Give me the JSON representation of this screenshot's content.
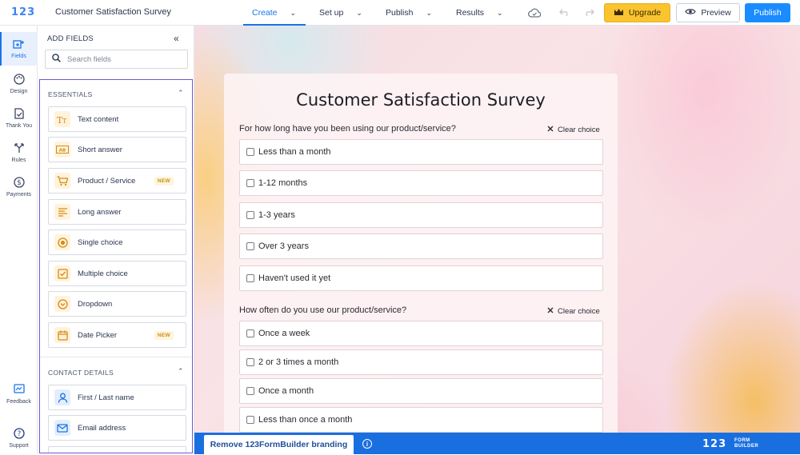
{
  "app": {
    "logo": "123",
    "form_title": "Customer Satisfaction Survey"
  },
  "nav": [
    {
      "label": "Create",
      "active": true
    },
    {
      "label": "Set up",
      "active": false
    },
    {
      "label": "Publish",
      "active": false
    },
    {
      "label": "Results",
      "active": false
    }
  ],
  "toolbar": {
    "cloud_icon": "cloud-icon",
    "undo_icon": "undo-icon",
    "redo_icon": "redo-icon",
    "upgrade_label": "Upgrade",
    "preview_label": "Preview",
    "publish_label": "Publish",
    "colors": {
      "upgrade": "#f9c430",
      "publish": "#1a8cff",
      "accent": "#1a73e8"
    }
  },
  "rail": {
    "items": [
      {
        "label": "Fields",
        "icon": "fields-icon",
        "active": true
      },
      {
        "label": "Design",
        "icon": "palette-icon",
        "active": false
      },
      {
        "label": "Thank You",
        "icon": "thankyou-icon",
        "active": false
      },
      {
        "label": "Rules",
        "icon": "rules-icon",
        "active": false
      },
      {
        "label": "Payments",
        "icon": "dollar-icon",
        "active": false
      }
    ],
    "feedback_label": "Feedback",
    "support_label": "Support"
  },
  "panel": {
    "title": "ADD FIELDS",
    "search_placeholder": "Search fields",
    "sections": [
      {
        "title": "ESSENTIALS",
        "fields": [
          {
            "label": "Text content",
            "icon": "text-content-icon",
            "badge": ""
          },
          {
            "label": "Short answer",
            "icon": "short-answer-icon",
            "badge": ""
          },
          {
            "label": "Product / Service",
            "icon": "cart-icon",
            "badge": "NEW"
          },
          {
            "label": "Long answer",
            "icon": "long-answer-icon",
            "badge": ""
          },
          {
            "label": "Single choice",
            "icon": "radio-icon",
            "badge": ""
          },
          {
            "label": "Multiple choice",
            "icon": "checkbox-icon",
            "badge": ""
          },
          {
            "label": "Dropdown",
            "icon": "dropdown-icon",
            "badge": ""
          },
          {
            "label": "Date Picker",
            "icon": "calendar-icon",
            "badge": "NEW"
          }
        ]
      },
      {
        "title": "CONTACT DETAILS",
        "fields": [
          {
            "label": "First / Last name",
            "icon": "person-icon",
            "badge": ""
          },
          {
            "label": "Email address",
            "icon": "email-icon",
            "badge": ""
          }
        ]
      }
    ]
  },
  "form": {
    "title": "Customer Satisfaction Survey",
    "clear_label": "Clear choice",
    "questions": [
      {
        "label": "For how long have you been using our product/service?",
        "options": [
          "Less than a month",
          "1-12 months",
          "1-3 years",
          "Over 3 years",
          "Haven't used it yet"
        ]
      },
      {
        "label": "How often do you use our product/service?",
        "options": [
          "Once a week",
          "2 or 3 times a month",
          "Once a month",
          "Less than once a month"
        ]
      }
    ]
  },
  "bottombar": {
    "remove_branding_label": "Remove 123FormBuilder branding",
    "info_icon": "info-icon",
    "logo_main": "123",
    "logo_sub_1": "FORM",
    "logo_sub_2": "BUILDER"
  }
}
